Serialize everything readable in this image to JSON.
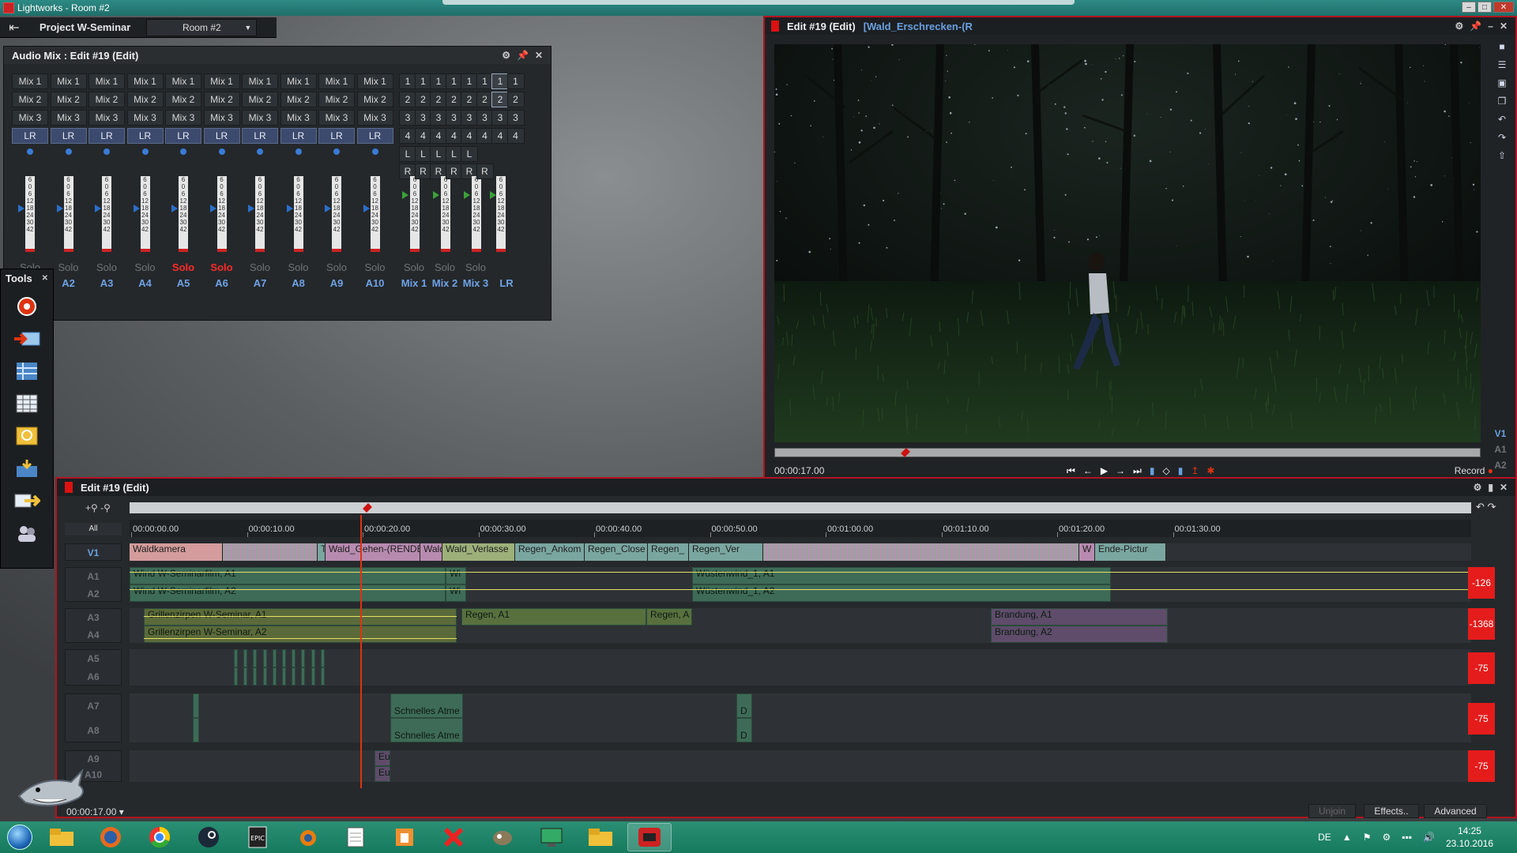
{
  "os": {
    "title": "Lightworks - Room #2"
  },
  "project": {
    "name": "Project W-Seminar",
    "room": "Room #2"
  },
  "audio_mix": {
    "title": "Audio Mix : Edit #19 (Edit)",
    "channels": [
      {
        "mix1": "Mix 1",
        "mix2": "Mix 2",
        "mix3": "Mix 3",
        "lr": "LR",
        "solo": "Solo",
        "solo_on": false,
        "label": ""
      },
      {
        "mix1": "Mix 1",
        "mix2": "Mix 2",
        "mix3": "Mix 3",
        "lr": "LR",
        "solo": "Solo",
        "solo_on": false,
        "label": "A2"
      },
      {
        "mix1": "Mix 1",
        "mix2": "Mix 2",
        "mix3": "Mix 3",
        "lr": "LR",
        "solo": "Solo",
        "solo_on": false,
        "label": "A3"
      },
      {
        "mix1": "Mix 1",
        "mix2": "Mix 2",
        "mix3": "Mix 3",
        "lr": "LR",
        "solo": "Solo",
        "solo_on": false,
        "label": "A4"
      },
      {
        "mix1": "Mix 1",
        "mix2": "Mix 2",
        "mix3": "Mix 3",
        "lr": "LR",
        "solo": "Solo",
        "solo_on": true,
        "label": "A5"
      },
      {
        "mix1": "Mix 1",
        "mix2": "Mix 2",
        "mix3": "Mix 3",
        "lr": "LR",
        "solo": "Solo",
        "solo_on": true,
        "label": "A6"
      },
      {
        "mix1": "Mix 1",
        "mix2": "Mix 2",
        "mix3": "Mix 3",
        "lr": "LR",
        "solo": "Solo",
        "solo_on": false,
        "label": "A7"
      },
      {
        "mix1": "Mix 1",
        "mix2": "Mix 2",
        "mix3": "Mix 3",
        "lr": "LR",
        "solo": "Solo",
        "solo_on": false,
        "label": "A8"
      },
      {
        "mix1": "Mix 1",
        "mix2": "Mix 2",
        "mix3": "Mix 3",
        "lr": "LR",
        "solo": "Solo",
        "solo_on": false,
        "label": "A9"
      },
      {
        "mix1": "Mix 1",
        "mix2": "Mix 2",
        "mix3": "Mix 3",
        "lr": "LR",
        "solo": "Solo",
        "solo_on": false,
        "label": "A10"
      }
    ],
    "number_cols": [
      {
        "r": [
          "1",
          "2",
          "3",
          "4"
        ],
        "l": "L",
        "rr": "R",
        "solo": "Solo",
        "label": "Mix 1"
      },
      {
        "r": [
          "1",
          "2",
          "3",
          "4"
        ],
        "l": "L",
        "rr": "R",
        "solo": "",
        "label": ""
      },
      {
        "r": [
          "1",
          "2",
          "3",
          "4"
        ],
        "l": "L",
        "rr": "R",
        "solo": "Solo",
        "label": "Mix 2"
      },
      {
        "r": [
          "1",
          "2",
          "3",
          "4"
        ],
        "l": "L",
        "rr": "R",
        "solo": "",
        "label": ""
      },
      {
        "r": [
          "1",
          "2",
          "3",
          "4"
        ],
        "l": "L",
        "rr": "R",
        "solo": "Solo",
        "label": "Mix 3"
      },
      {
        "r": [
          "1",
          "2",
          "3",
          "4"
        ],
        "l": "",
        "rr": "R",
        "solo": "",
        "label": ""
      },
      {
        "r": [
          "1",
          "2",
          "3",
          "4"
        ],
        "l": "",
        "rr": "",
        "solo": "",
        "label": "LR"
      },
      {
        "r": [
          "1",
          "2",
          "3",
          "4"
        ],
        "l": "",
        "rr": "",
        "solo": "",
        "label": ""
      }
    ],
    "fader_scale": [
      "6",
      "0",
      "6",
      "12",
      "18",
      "24",
      "30",
      "42"
    ]
  },
  "tools": {
    "title": "Tools"
  },
  "viewer": {
    "title": "Edit #19 (Edit)",
    "subtitle": "[Wald_Erschrecken-(R",
    "timecode": "00:00:17.00",
    "record_label": "Record",
    "tracks": [
      "V1",
      "A1",
      "A2"
    ]
  },
  "timeline": {
    "title": "Edit #19 (Edit)",
    "all_label": "All",
    "ruler": [
      "00:00:00.00",
      "00:00:10.00",
      "00:00:20.00",
      "00:00:30.00",
      "00:00:40.00",
      "00:00:50.00",
      "00:01:00.00",
      "00:01:10.00",
      "00:01:20.00",
      "00:01:30.00"
    ],
    "track_labels": {
      "v1": "V1",
      "a1": "A1",
      "a2": "A2",
      "a3": "A3",
      "a4": "A4",
      "a5": "A5",
      "a6": "A6",
      "a7": "A7",
      "a8": "A8",
      "a9": "A9",
      "a10": "A10"
    },
    "v1_clips": [
      "Waldkamera",
      "T",
      "Wald_Gehen-(RENDER",
      "Wald",
      "Wald_Verlasse",
      "Regen_Ankom",
      "Regen_Close",
      "Regen_",
      "Regen_Ver",
      "W",
      "Ende-Pictur"
    ],
    "a1_clips": [
      "Wind W-Seminarfilm, A1",
      "Wi",
      "Wüstenwind_1, A1"
    ],
    "a2_clips": [
      "Wind W-Seminarfilm, A2",
      "Wi",
      "Wüstenwind_1, A2"
    ],
    "a3_clips": [
      "Grillenzirpen W-Seminar, A1",
      "Regen, A1",
      "Regen, A",
      "Brandung, A1"
    ],
    "a4_clips": [
      "Grillenzirpen W-Seminar, A2",
      "Brandung, A2"
    ],
    "a7_clips": [
      "Schnelles Atme",
      "D"
    ],
    "a8_clips": [
      "Schnelles Atme",
      "D"
    ],
    "a9_clips": [
      "Eu"
    ],
    "a10_clips": [
      "Eu"
    ],
    "volumes": [
      "-126",
      "-1368",
      "-75",
      "-75",
      "-75"
    ],
    "timecode": "00:00:17.00",
    "buttons": {
      "unjoin": "Unjoin",
      "effects": "Effects..",
      "advanced": "Advanced"
    }
  },
  "taskbar": {
    "lang": "DE",
    "time": "14:25",
    "date": "23.10.2016"
  }
}
